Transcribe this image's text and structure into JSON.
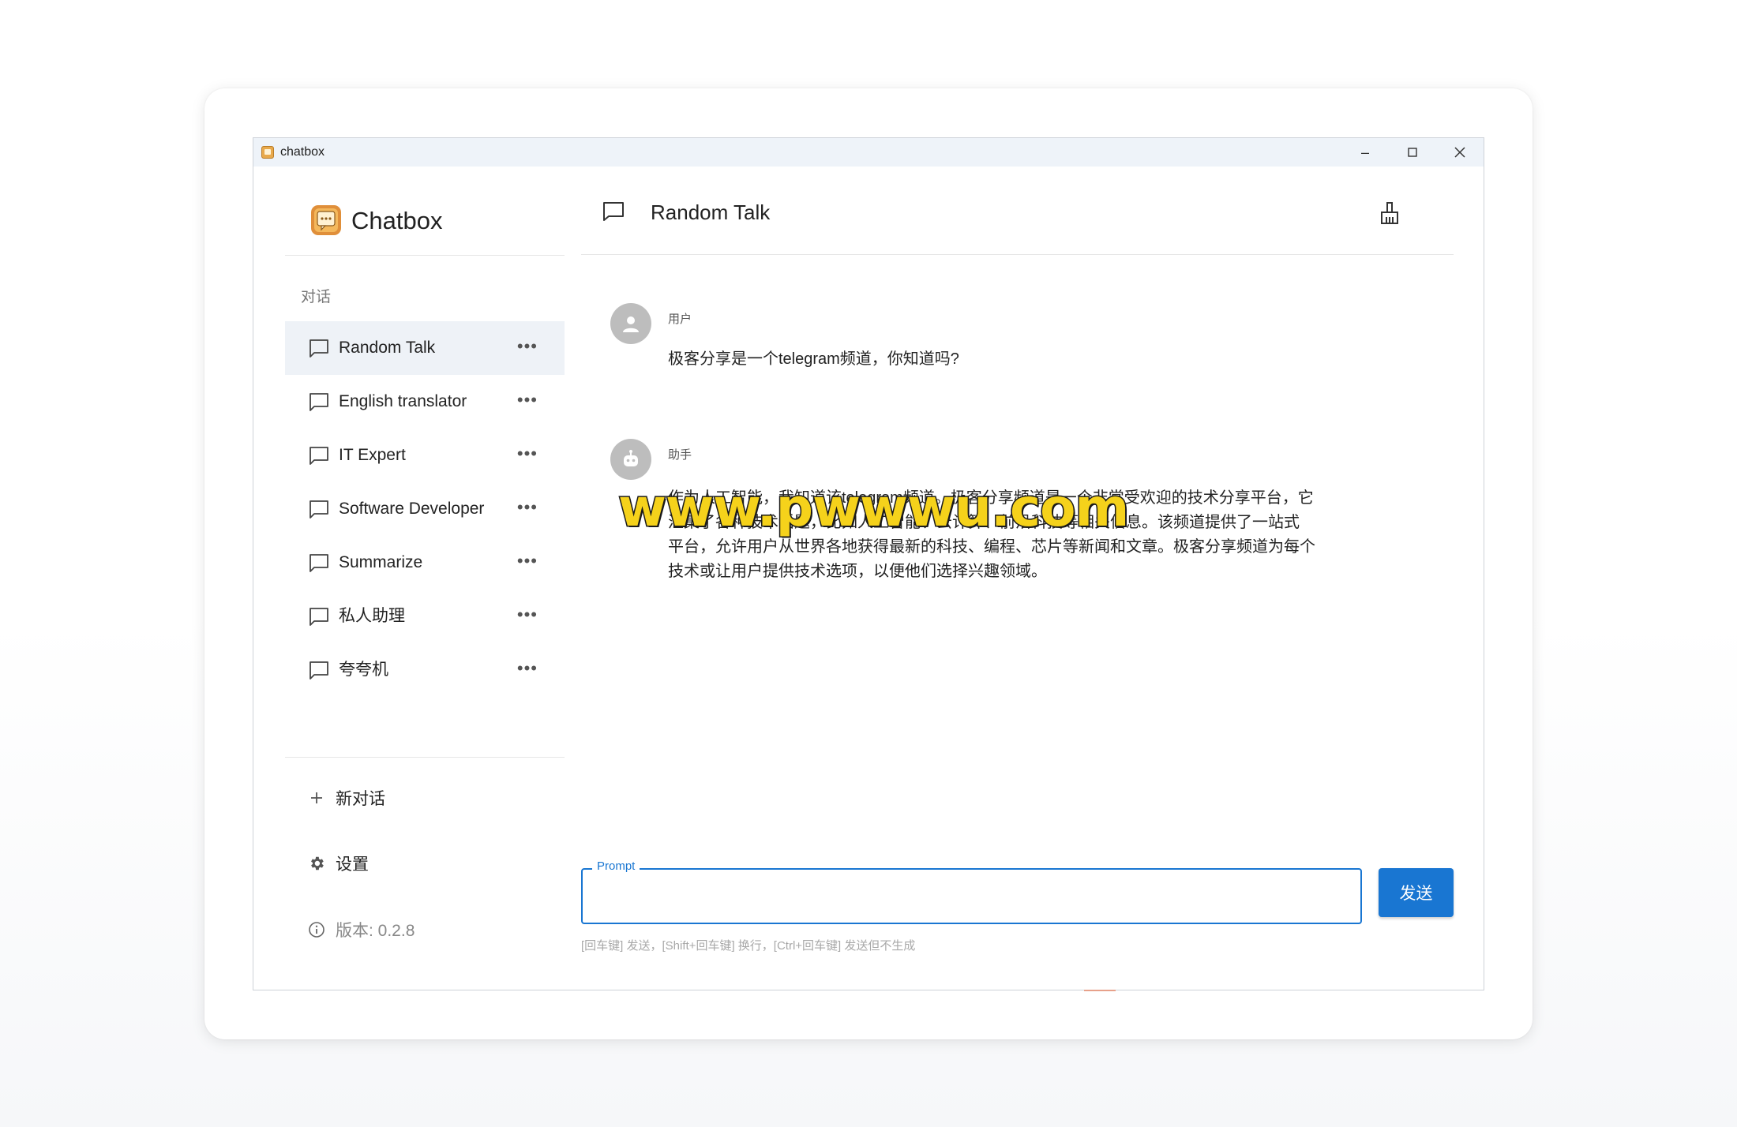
{
  "window": {
    "title": "chatbox",
    "controls": {
      "minimize": "–",
      "maximize": "☐",
      "close": "✕"
    }
  },
  "sidebar": {
    "app_name": "Chatbox",
    "section_label": "对话",
    "conversations": [
      {
        "label": "Random Talk",
        "active": true
      },
      {
        "label": "English translator"
      },
      {
        "label": "IT Expert"
      },
      {
        "label": "Software Developer"
      },
      {
        "label": "Summarize"
      },
      {
        "label": "私人助理"
      },
      {
        "label": "夸夸机"
      }
    ],
    "more_glyph": "•••",
    "new_chat_label": "新对话",
    "settings_label": "设置",
    "version_label": "版本: 0.2.8"
  },
  "main": {
    "title": "Random Talk",
    "messages": [
      {
        "role": "用户",
        "text": "极客分享是一个telegram频道，你知道吗?"
      },
      {
        "role": "助手",
        "lines": [
          "作为人工智能，我知道该telegram频道。极客分享频道是一个非常受欢迎的技术分享平台，它",
          "汇集了各种技术话题，比如人工智能、云计算、前沿科技等相关信息。该频道提供了一站式",
          "平台，允许用户从世界各地获得最新的科技、编程、芯片等新闻和文章。极客分享频道为每个",
          "技术或让用户提供技术选项，以便他们选择兴趣领域。"
        ]
      }
    ],
    "watermark": "www.pwwwu.com",
    "prompt": {
      "label": "Prompt",
      "value": ""
    },
    "send_label": "发送",
    "hint": "[回车键] 发送，[Shift+回车键] 换行，[Ctrl+回车键] 发送但不生成"
  },
  "colors": {
    "accent": "#1976d2",
    "active_row": "#eef2f7",
    "watermark": "#f5d21b"
  }
}
